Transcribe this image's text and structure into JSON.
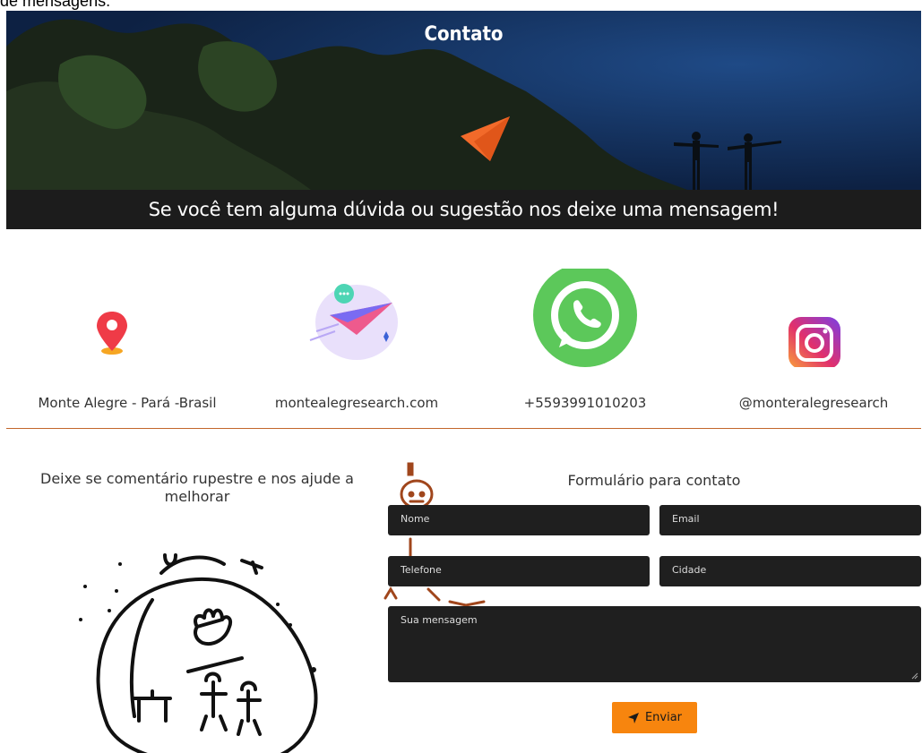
{
  "top_text": "de mensagens.",
  "hero": {
    "title": "Contato"
  },
  "banner": {
    "text": "Se você tem alguma dúvida ou sugestão nos deixe uma mensagem!"
  },
  "contacts": [
    {
      "icon": "location-pin-icon",
      "label": "Monte Alegre - Pará -Brasil"
    },
    {
      "icon": "paper-plane-email-icon",
      "label": "montealegresearch.com"
    },
    {
      "icon": "whatsapp-icon",
      "label": "+5593991010203"
    },
    {
      "icon": "instagram-icon",
      "label": "@monteralegresearch"
    }
  ],
  "left_section": {
    "title": "Deixe se comentário rupestre e nos ajude a melhorar"
  },
  "form": {
    "title": "Formulário para contato",
    "name_placeholder": "Nome",
    "email_placeholder": "Email",
    "phone_placeholder": "Telefone",
    "city_placeholder": "Cidade",
    "message_placeholder": "Sua mensagem",
    "submit_label": "Enviar"
  },
  "colors": {
    "accent": "#f7850e",
    "divider": "#c2662a",
    "dark": "#1f1f1f"
  }
}
